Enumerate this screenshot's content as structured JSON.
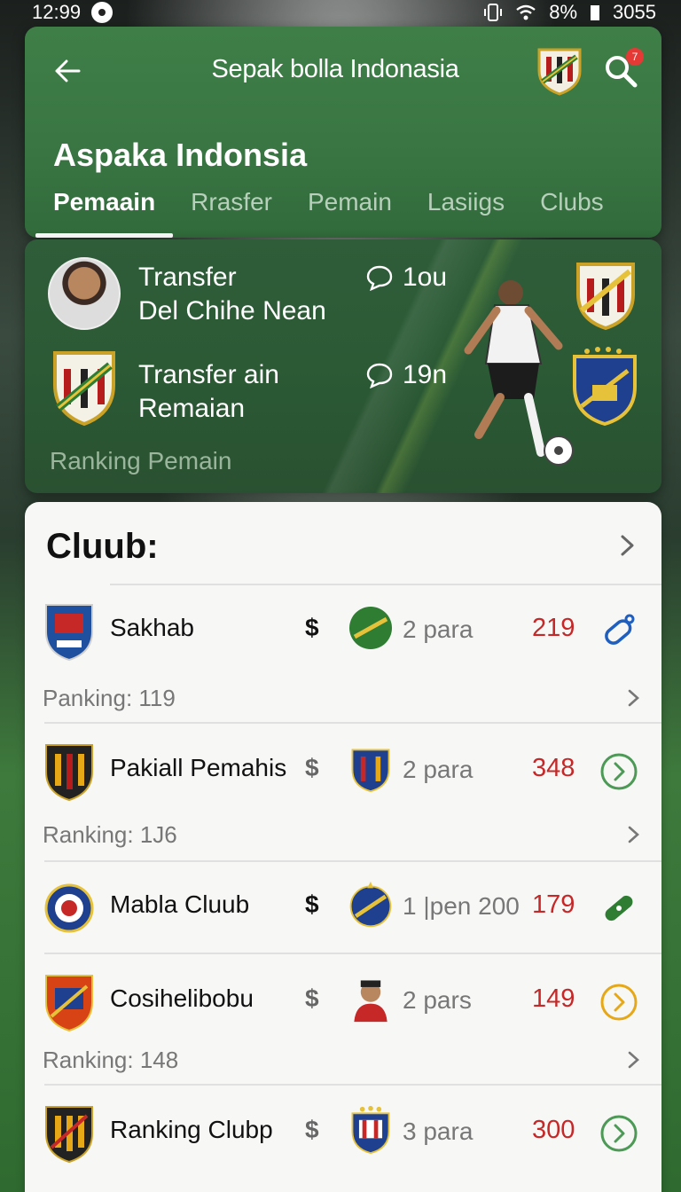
{
  "status": {
    "time": "12:99",
    "battery": "8%",
    "right_text": "3055"
  },
  "header": {
    "title": "Sepak bolla Indonasia",
    "notif_count": "7",
    "section_title": "Aspaka Indonsia",
    "tabs": [
      {
        "label": "Pemaain"
      },
      {
        "label": "Rrasfer"
      },
      {
        "label": "Pemain"
      },
      {
        "label": "Lasiigs"
      },
      {
        "label": "Clubs"
      }
    ]
  },
  "banner": {
    "rows": [
      {
        "line1": "Transfer",
        "line2": "Del Chihe Nean",
        "count": "1ou"
      },
      {
        "line1": "Transfer ain",
        "line2": "Remaian",
        "count": "19n"
      }
    ],
    "footer": "Ranking Pemain"
  },
  "clubs": {
    "heading": "Cluub:",
    "items": [
      {
        "name": "Sakhab",
        "money": "$",
        "para": "2 para",
        "score": "219",
        "ranking": "Panking: 119",
        "action": "tag-icon"
      },
      {
        "name": "Pakiall Pemahis",
        "money": "$",
        "para": "2 para",
        "score": "348",
        "ranking": "Ranking: 1J6",
        "action": "chevron-circle-green"
      },
      {
        "name": "Mabla Cluub",
        "money": "$",
        "para": "1 |pen 200",
        "score": "179",
        "ranking": "",
        "action": "bandage-icon"
      },
      {
        "name": "Cosihelibobu",
        "money": "$",
        "para": "2 pars",
        "score": "149",
        "ranking": "Ranking: 148",
        "action": "chevron-circle-gold"
      },
      {
        "name": "Ranking Clubp",
        "money": "$",
        "para": "3 para",
        "score": "300",
        "ranking": "",
        "action": "chevron-circle-green"
      }
    ]
  },
  "colors": {
    "header_green": "#3f7f47",
    "score_red": "#c62828",
    "accent_gold": "#e6a817"
  }
}
